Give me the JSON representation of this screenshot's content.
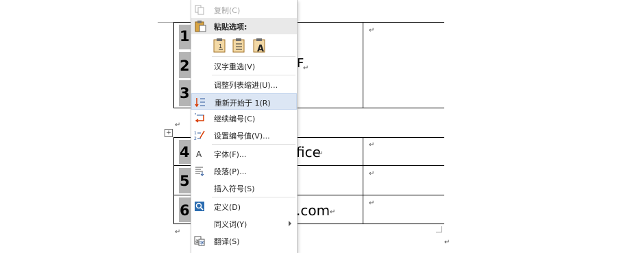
{
  "document": {
    "row_numbers": [
      "1.",
      "2.",
      "3.",
      "4.",
      "5.",
      "6."
    ],
    "visible_text": {
      "row2_fragment": "F",
      "row4_fragment": "fice",
      "row6_fragment": ".com"
    },
    "paragraph_mark": "↵"
  },
  "menu": {
    "copy": "复制(C)",
    "paste_options": "粘贴选项:",
    "paste_icons": [
      "paste-keep-format-icon",
      "paste-merge-list-icon",
      "paste-text-only-icon"
    ],
    "reconvert": "汉字重选(V)",
    "adjust_list_indent": "调整列表缩进(U)...",
    "restart_at": "重新开始于 1(R)",
    "continue_numbering": "继续编号(C)",
    "set_numbering_value": "设置编号值(V)...",
    "font": "字体(F)...",
    "paragraph": "段落(P)...",
    "insert_symbol": "插入符号(S)",
    "define": "定义(D)",
    "synonyms": "同义词(Y)",
    "translate": "翻译(S)"
  },
  "colors": {
    "hover_bg": "#dce6f4",
    "section_bg": "#e9e9e9",
    "numbering_icon_red": "#d83b01",
    "numbering_icon_blue": "#2b579a"
  }
}
